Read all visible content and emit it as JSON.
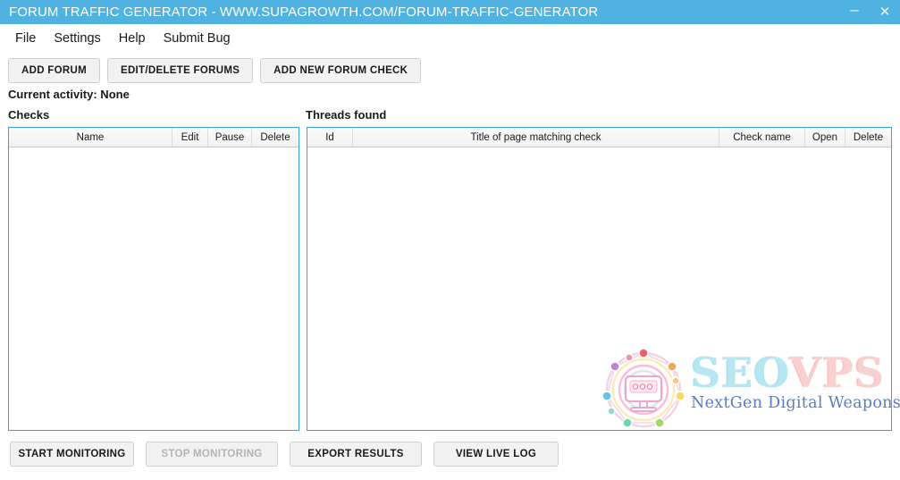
{
  "window": {
    "title": "FORUM TRAFFIC GENERATOR - WWW.SUPAGROWTH.COM/FORUM-TRAFFIC-GENERATOR",
    "minimize_glyph": "–",
    "close_glyph": "✕",
    "titlebar_color": "#4fb2e0"
  },
  "menu": {
    "items": [
      {
        "label": "File"
      },
      {
        "label": "Settings"
      },
      {
        "label": "Help"
      },
      {
        "label": "Submit Bug"
      }
    ]
  },
  "toolbar": {
    "add_forum_label": "ADD FORUM",
    "edit_delete_forums_label": "EDIT/DELETE FORUMS",
    "add_new_forum_check_label": "ADD NEW FORUM CHECK"
  },
  "status": {
    "activity_text": "Current activity: None"
  },
  "checks": {
    "panel_label": "Checks",
    "columns": [
      "Name",
      "Edit",
      "Pause",
      "Delete"
    ],
    "rows": []
  },
  "threads": {
    "panel_label": "Threads found",
    "columns": [
      "Id",
      "Title of page matching check",
      "Check name",
      "Open",
      "Delete"
    ],
    "rows": []
  },
  "watermark": {
    "main_part1": "SEO",
    "main_part2": "VPS",
    "tagline": "NextGen Digital Weapons",
    "color_seo": "#b3e6f2",
    "color_vps": "#f9cfcf",
    "color_tagline": "#5577c4"
  },
  "footer": {
    "start_monitoring_label": "START MONITORING",
    "stop_monitoring_label": "STOP MONITORING",
    "export_results_label": "EXPORT RESULTS",
    "view_live_log_label": "VIEW LIVE LOG"
  }
}
